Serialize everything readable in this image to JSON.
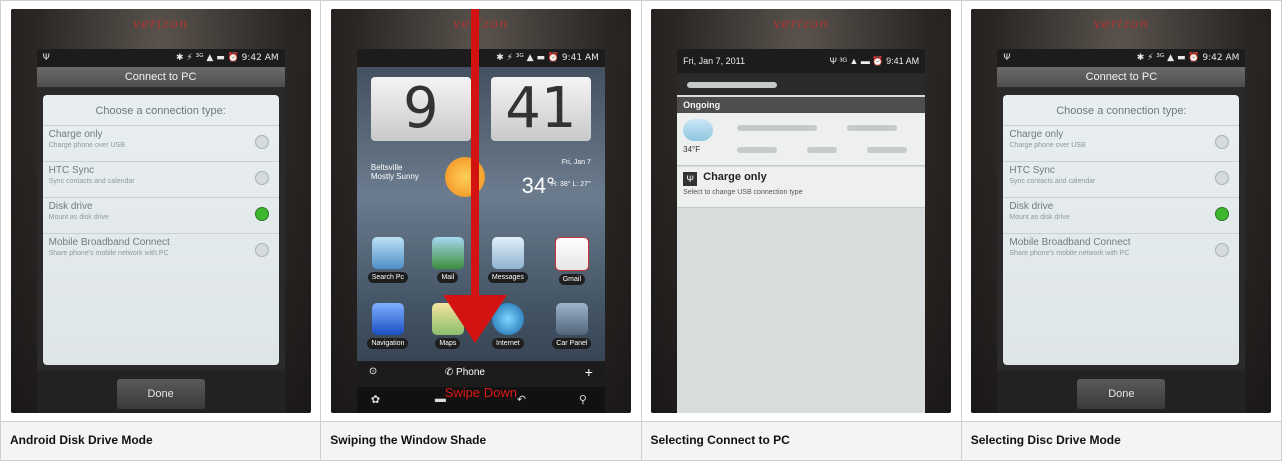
{
  "panels": [
    {
      "caption": "Android Disk Drive Mode",
      "brand": "verizon",
      "status_left": "Ψ",
      "status_right": "✱ ⚡ ³ᴳ ▲ ▬ ⏰ 9:42 AM",
      "dialog_header": "Connect to PC",
      "dialog_title": "Choose a connection type:",
      "options": [
        {
          "title": "Charge only",
          "subtitle": "Charge phone over USB",
          "selected": false
        },
        {
          "title": "HTC Sync",
          "subtitle": "Sync contacts and calendar",
          "selected": false
        },
        {
          "title": "Disk drive",
          "subtitle": "Mount as disk drive",
          "selected": true
        },
        {
          "title": "Mobile Broadband Connect",
          "subtitle": "Share phone's mobile network with PC",
          "selected": false
        }
      ],
      "done_label": "Done"
    },
    {
      "caption": "Swiping the Window Shade",
      "brand": "verizon",
      "status_right": "✱ ⚡ ³ᴳ ▲ ▬ ⏰ 9:41 AM",
      "clock_hour": "9",
      "clock_minute": "41",
      "weather_location": "Beltsville",
      "weather_condition": "Mostly Sunny",
      "weather_date": "Fri, Jan 7",
      "weather_temp": "34°",
      "weather_hilo": "H: 38°  L: 27°",
      "apps": [
        "Search Pc",
        "Mail",
        "Messages",
        "Gmail",
        "Navigation",
        "Maps",
        "Internet",
        "Car Panel"
      ],
      "dock_phone": "Phone",
      "swipe_label": "Swipe Down"
    },
    {
      "caption": "Selecting Connect to PC",
      "brand": "verizon",
      "date": "Fri, Jan 7, 2011",
      "status_right": "Ψ ³ᴳ ▲ ▬ ⏰ 9:41 AM",
      "ongoing_label": "Ongoing",
      "weather_temp": "34°F",
      "notif_title": "Charge only",
      "notif_subtitle": "Select to change USB connection type"
    },
    {
      "caption": "Selecting Disc Drive Mode",
      "brand": "verizon",
      "status_left": "Ψ",
      "status_right": "✱ ⚡ ³ᴳ ▲ ▬ ⏰ 9:42 AM",
      "dialog_header": "Connect to PC",
      "dialog_title": "Choose a connection type:",
      "options": [
        {
          "title": "Charge only",
          "subtitle": "Charge phone over USB",
          "selected": false
        },
        {
          "title": "HTC Sync",
          "subtitle": "Sync contacts and calendar",
          "selected": false
        },
        {
          "title": "Disk drive",
          "subtitle": "Mount as disk drive",
          "selected": true
        },
        {
          "title": "Mobile Broadband Connect",
          "subtitle": "Share phone's mobile network with PC",
          "selected": false
        }
      ],
      "done_label": "Done"
    }
  ]
}
